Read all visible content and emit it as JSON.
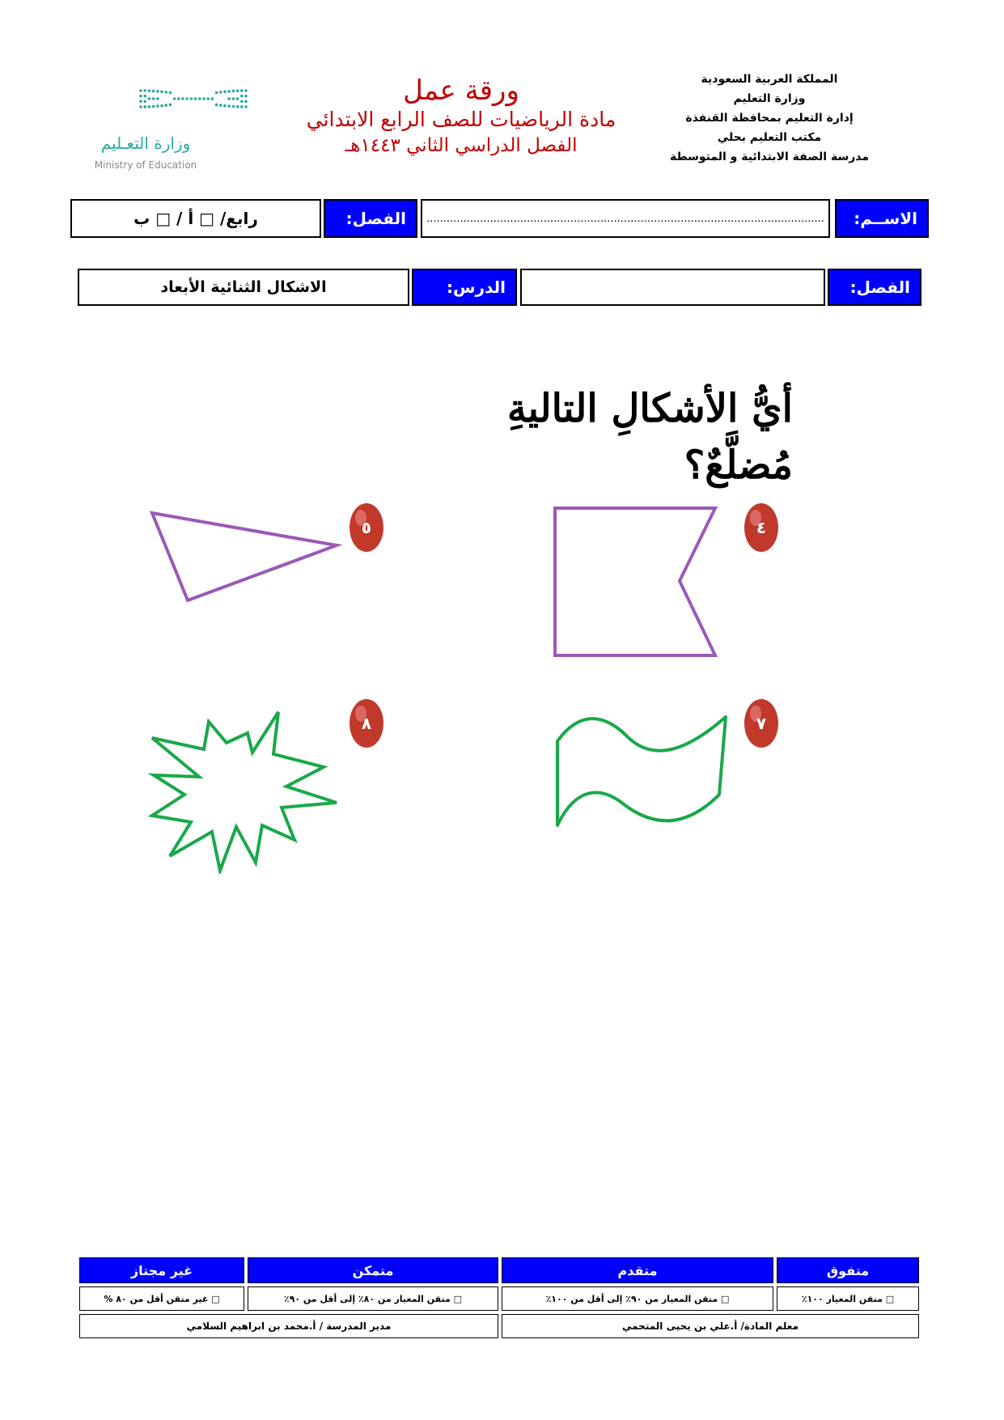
{
  "header": {
    "ministry_lines": [
      "المملكة العربية السعودية",
      "وزارة التعليم",
      "إدارة التعليم بمحافظة القنفذة",
      "مكتب التعليم بحلي",
      "مدرسة الصفة الابتدائية و المتوسطة"
    ],
    "title": "ورقة عمل",
    "subject_line": "مادة الرياضيات للصف الرابع الابتدائي",
    "term_line": "الفصل الدراسي الثاني ١٤٤٣هـ",
    "logo_ar": "وزارة التعـليم",
    "logo_en": "Ministry of Education",
    "logo_color": "#2aa9a0"
  },
  "info_row1": {
    "name_label": "الاســم:",
    "name_value": ".......................................................................................................................",
    "class_label": "الفصل:",
    "class_value": "رابع/ □ أ / □ ب"
  },
  "info_row2": {
    "class_label": "الفصل:",
    "class_value": "",
    "lesson_label": "الدرس:",
    "lesson_value": "الاشكال الثنائية الأبعاد"
  },
  "question": "أيُّ الأشكالِ التاليةِ مُضلَّعٌ؟",
  "shapes": [
    {
      "number": "٤",
      "icon": "flag-shape",
      "color": "#9b59b6"
    },
    {
      "number": "٥",
      "icon": "triangle-shape",
      "color": "#9b59b6"
    },
    {
      "number": "٧",
      "icon": "wavy-flag-shape",
      "color": "#1aa84a"
    },
    {
      "number": "٨",
      "icon": "starburst-shape",
      "color": "#1aa84a"
    }
  ],
  "badge_color": "#c0392b",
  "rubric": {
    "headers": [
      "متفوق",
      "متقدم",
      "متمكن",
      "غير مجتاز"
    ],
    "criteria": [
      "□ متقن المعيار ١٠٠٪",
      "□ متقن المعيار من ٩٠٪  إلى أقل من ١٠٠٪",
      "□ متقن المعيار من ٨٠٪ إلى أقل من ٩٠٪",
      "□ غير متقن أقل من ٨٠ %"
    ],
    "teacher": "معلم المادة/ أ.علي بن يحيى المتحمي",
    "principal": "مدير المدرسة / أ.محمد بن ابراهيم السلامي"
  },
  "colors": {
    "header_blue": "#0000ff",
    "title_red": "#c00000"
  }
}
